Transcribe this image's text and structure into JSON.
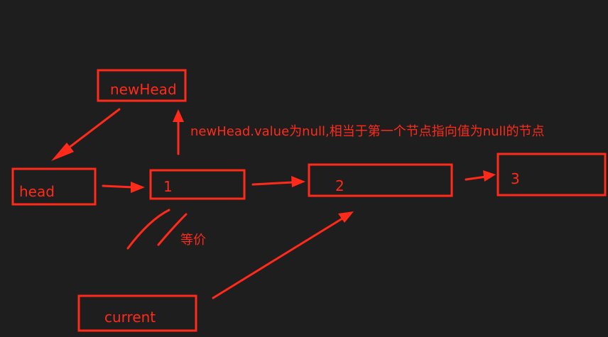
{
  "nodes": {
    "newHead": "newHead",
    "head": "head",
    "node1": "1",
    "node2": "2",
    "node3": "3",
    "current": "current"
  },
  "annotations": {
    "newhead_note": "newHead.value为null,相当于第一个节点指向值为null的节点",
    "equivalent": "等价"
  },
  "colors": {
    "background": "#1e1e1e",
    "accent": "#ff2a1a"
  }
}
